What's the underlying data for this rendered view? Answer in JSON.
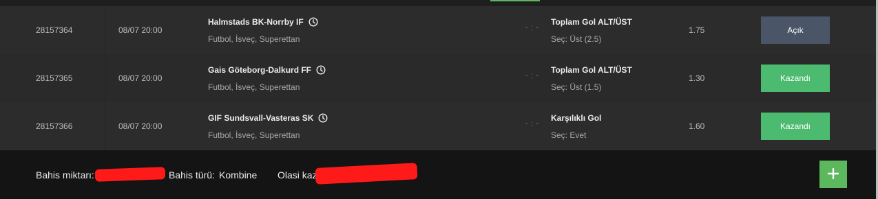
{
  "bets": [
    {
      "id": "28157364",
      "date": "08/07 20:00",
      "match": "Halmstads BK-Norrby IF",
      "league": "Futbol, İsveç, Superettan",
      "score": "- : -",
      "market": "Toplam Gol ALT/ÜST",
      "selection": "Seç:  Üst (2.5)",
      "odds": "1.75",
      "status": "Açık"
    },
    {
      "id": "28157365",
      "date": "08/07 20:00",
      "match": "Gais Göteborg-Dalkurd FF",
      "league": "Futbol, İsveç, Superettan",
      "score": "- : -",
      "market": "Toplam Gol ALT/ÜST",
      "selection": "Seç:  Üst (1.5)",
      "odds": "1.30",
      "status": "Kazandı"
    },
    {
      "id": "28157366",
      "date": "08/07 20:00",
      "match": "GIF Sundsvall-Vasteras SK",
      "league": "Futbol, İsveç, Superettan",
      "score": "- : -",
      "market": "Karşılıklı Gol",
      "selection": "Seç:  Evet",
      "odds": "1.60",
      "status": "Kazandı"
    }
  ],
  "footer": {
    "stake_label": "Bahis miktarı:",
    "bet_type_label": "Bahis türü:",
    "bet_type_value": "Kombine",
    "potential_win_label": "Olasi kazanç:",
    "add_icon": "plus-icon"
  },
  "colors": {
    "accent_green": "#5cb85c",
    "won_button": "#4cba6f",
    "open_button": "#4a5568",
    "redaction": "#ff1a1a"
  }
}
